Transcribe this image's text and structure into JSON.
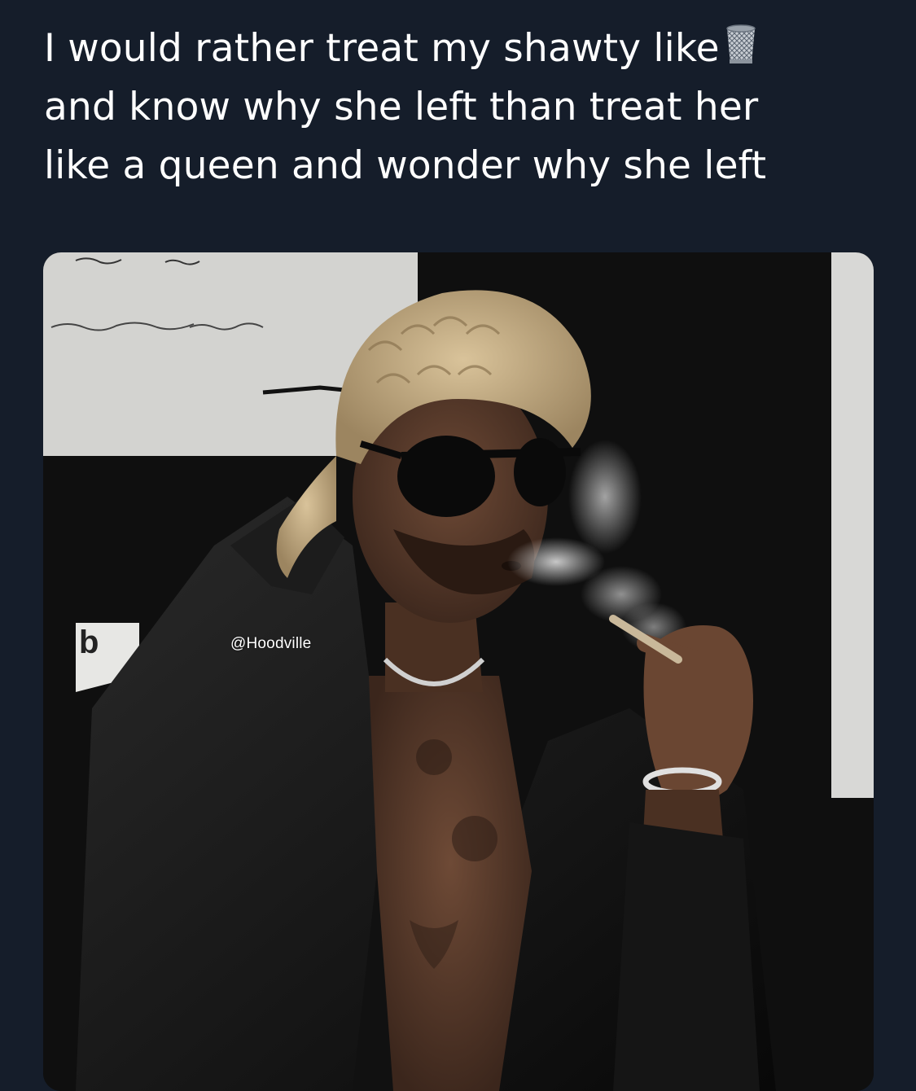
{
  "tweet": {
    "line1": "I would rather treat my shawty like",
    "line1_emoji": "wastebasket-icon",
    "line2": "and know why she left than treat her",
    "line3": "like a queen and wonder why she left"
  },
  "media": {
    "watermark": "@Hoodville"
  },
  "colors": {
    "background": "#151d2a",
    "text": "#ffffff"
  }
}
